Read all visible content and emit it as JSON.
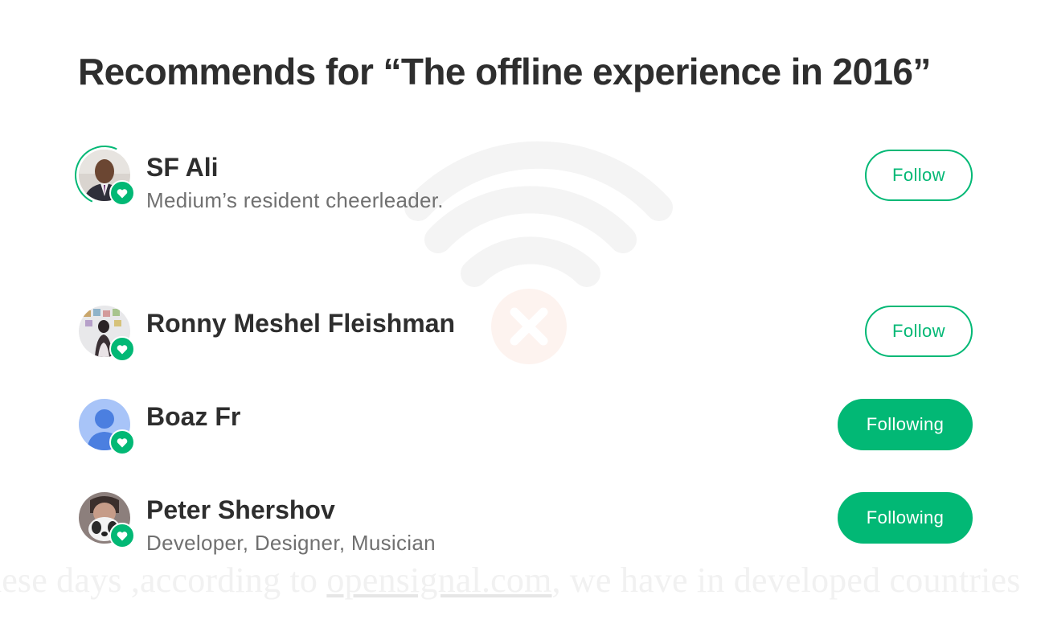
{
  "dialog": {
    "title": "Recommends for “The offline experience in 2016”"
  },
  "users": [
    {
      "name": "SF Ali",
      "bio": "Medium’s resident cheerleader.",
      "button_label": "Follow",
      "avatar_icon": "person-photo"
    },
    {
      "name": "Ronny Meshel Fleishman",
      "bio": "",
      "button_label": "Follow",
      "avatar_icon": "person-photo"
    },
    {
      "name": "Boaz Fr",
      "bio": "",
      "button_label": "Following",
      "avatar_icon": "default-user-icon"
    },
    {
      "name": "Peter Shershov",
      "bio": "Developer, Designer, Musician",
      "button_label": "Following",
      "avatar_icon": "person-photo"
    }
  ],
  "background_article": {
    "text_before": "hese days ,according to ",
    "link_text": "opensignal.com",
    "text_after": ", we have in developed countries"
  },
  "colors": {
    "accent": "#02b875",
    "title": "#2e2e2e",
    "bio": "#707070"
  }
}
